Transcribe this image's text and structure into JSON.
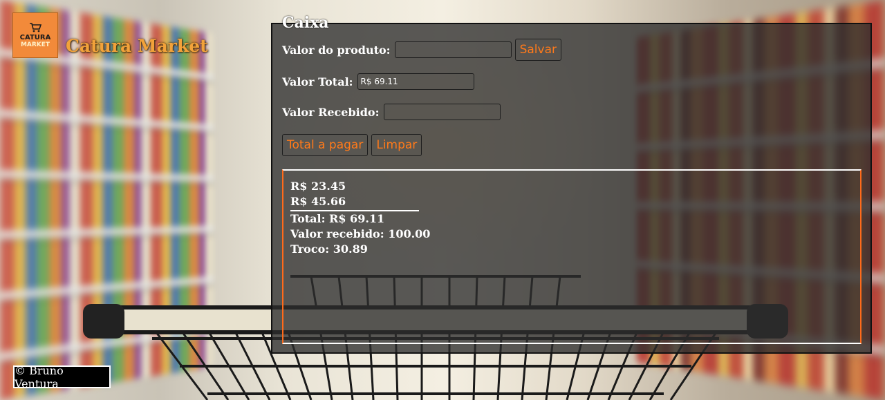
{
  "brand": {
    "logo_line1": "CATURA",
    "logo_line2": "MARKET",
    "name": "Catura Market"
  },
  "panel": {
    "title": "Caixa",
    "product_label": "Valor do produto:",
    "product_value": "",
    "save_button": "Salvar",
    "total_label": "Valor Total:",
    "total_value": "R$ 69.11",
    "received_label": "Valor Recebido:",
    "received_value": "",
    "pay_button": "Total a pagar",
    "clear_button": "Limpar"
  },
  "receipt": {
    "items": [
      "R$ 23.45",
      "R$ 45.66"
    ],
    "total": "Total: R$ 69.11",
    "received": "Valor recebido: 100.00",
    "change": "Troco: 30.89"
  },
  "footer": {
    "text": "© Bruno Ventura"
  },
  "colors": {
    "accent": "#ff7a1a",
    "brand_text": "#f2a23a",
    "panel_bg": "rgba(45,45,45,0.78)"
  }
}
